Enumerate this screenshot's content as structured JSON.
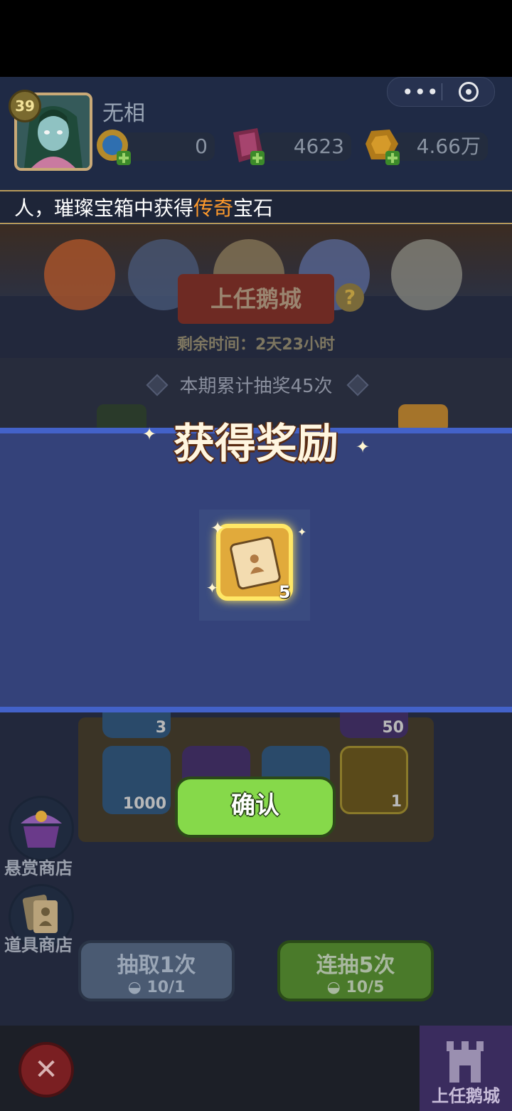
{
  "player": {
    "level": "39",
    "name": "无相"
  },
  "resources": {
    "blue_coin": "0",
    "gem": "4623",
    "gold": "4.66万"
  },
  "capsule": {
    "more": "•••"
  },
  "ticker": {
    "prefix": "人，璀璨宝箱中获得",
    "highlight": "传奇",
    "suffix": "宝石"
  },
  "event": {
    "banner": "上任鹅城",
    "help": "?",
    "timer": "剩余时间：2天23小时",
    "draw_total": "本期累计抽奖45次"
  },
  "modal": {
    "title": "获得奖励",
    "reward": {
      "icon": "scroll-icon",
      "count": "5"
    }
  },
  "slots": [
    {
      "num": "3"
    },
    {
      "num": "50"
    },
    {
      "num": "1000"
    },
    {
      "num": ""
    },
    {
      "num": ""
    },
    {
      "num": "1"
    }
  ],
  "confirm_label": "确认",
  "side": {
    "bounty_shop": "悬赏商店",
    "item_shop": "道具商店"
  },
  "draw": {
    "once": {
      "label": "抽取1次",
      "cost": "10/1"
    },
    "five": {
      "label": "连抽5次",
      "cost": "10/5"
    }
  },
  "bottom": {
    "close": "✕",
    "city": "上任鹅城"
  },
  "colors": {
    "accent_green": "#86d94a",
    "modal_blue": "#34427a",
    "highlight_orange": "#ff9a2c"
  }
}
